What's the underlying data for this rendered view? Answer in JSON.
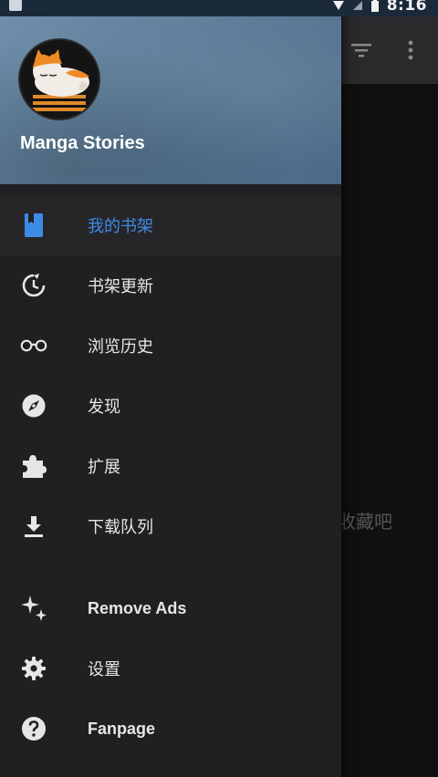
{
  "status_bar": {
    "time": "8:16"
  },
  "background": {
    "empty_text": "进行收藏吧",
    "icons": {
      "filter": "filter-icon",
      "more": "more-vertical-icon"
    }
  },
  "drawer": {
    "app_name": "Manga Stories",
    "menu": [
      {
        "label": "我的书架",
        "icon": "bookmark-book-icon",
        "active": true
      },
      {
        "label": "书架更新",
        "icon": "refresh-icon"
      },
      {
        "label": "浏览历史",
        "icon": "glasses-icon"
      },
      {
        "label": "发现",
        "icon": "compass-icon"
      },
      {
        "label": "扩展",
        "icon": "puzzle-icon"
      },
      {
        "label": "下载队列",
        "icon": "download-icon"
      }
    ],
    "extra_menu": [
      {
        "label": "Remove Ads",
        "icon": "sparkle-icon"
      },
      {
        "label": "设置",
        "icon": "gear-icon"
      },
      {
        "label": "Fanpage",
        "icon": "help-circle-icon"
      }
    ]
  },
  "colors": {
    "accent": "#3d8be6",
    "drawer_bg": "#202022",
    "header_bg": "#5f7f9b"
  }
}
